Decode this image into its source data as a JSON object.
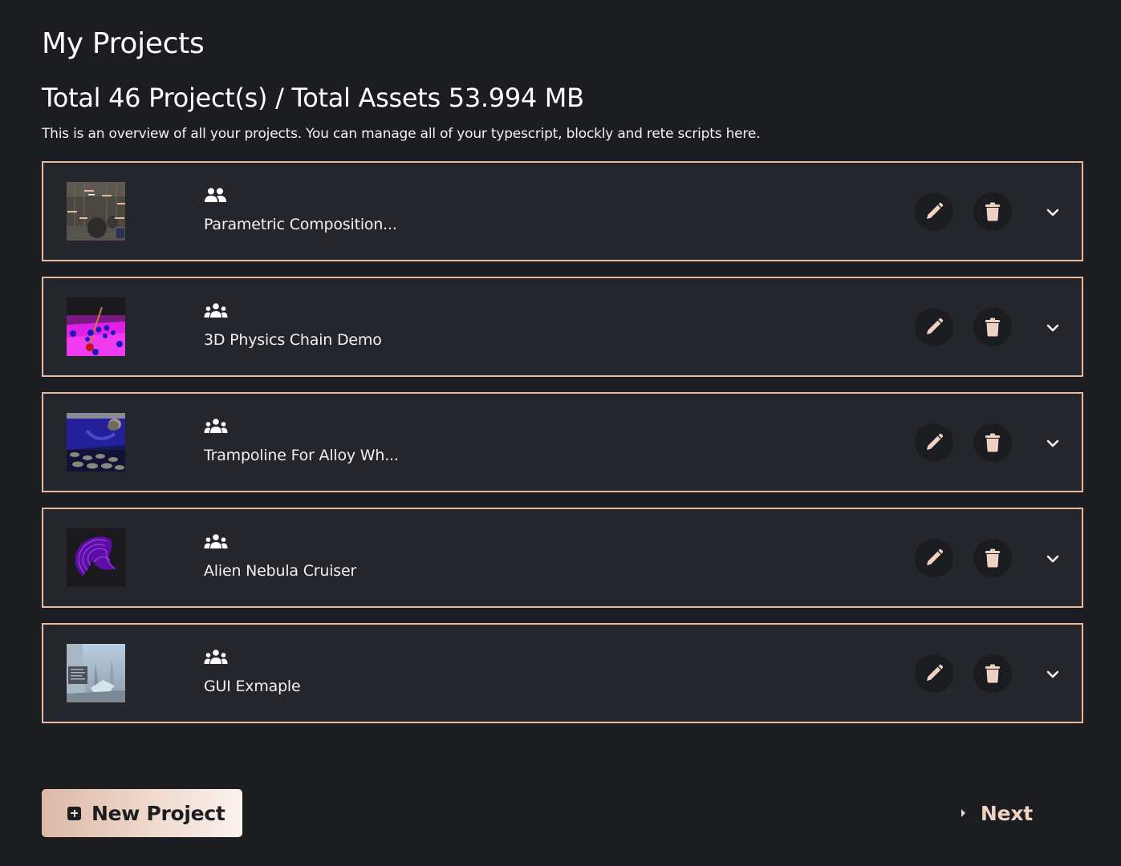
{
  "header": {
    "title": "My Projects",
    "summary": "Total 46 Project(s) / Total Assets 53.994 MB",
    "description": "This is an overview of all your projects. You can manage all of your typescript, blockly and rete scripts here."
  },
  "projects": [
    {
      "title": "Parametric Composition...",
      "sharing_icon": "user-friends-icon",
      "thumbnail": "parametric-composition-thumbnail"
    },
    {
      "title": "3D Physics Chain Demo",
      "sharing_icon": "users-icon",
      "thumbnail": "physics-chain-thumbnail"
    },
    {
      "title": "Trampoline For Alloy Wh...",
      "sharing_icon": "users-icon",
      "thumbnail": "trampoline-thumbnail"
    },
    {
      "title": "Alien Nebula Cruiser",
      "sharing_icon": "users-icon",
      "thumbnail": "nebula-cruiser-thumbnail"
    },
    {
      "title": "GUI Exmaple",
      "sharing_icon": "users-icon",
      "thumbnail": "gui-example-thumbnail"
    }
  ],
  "actions": {
    "edit_icon": "pencil-icon",
    "delete_icon": "trash-icon",
    "expand_icon": "chevron-down-icon"
  },
  "footer": {
    "new_project_label": "New Project",
    "next_label": "Next"
  },
  "colors": {
    "accent": "#e8b9a0",
    "background": "#1c1d21",
    "card": "#25262c"
  }
}
